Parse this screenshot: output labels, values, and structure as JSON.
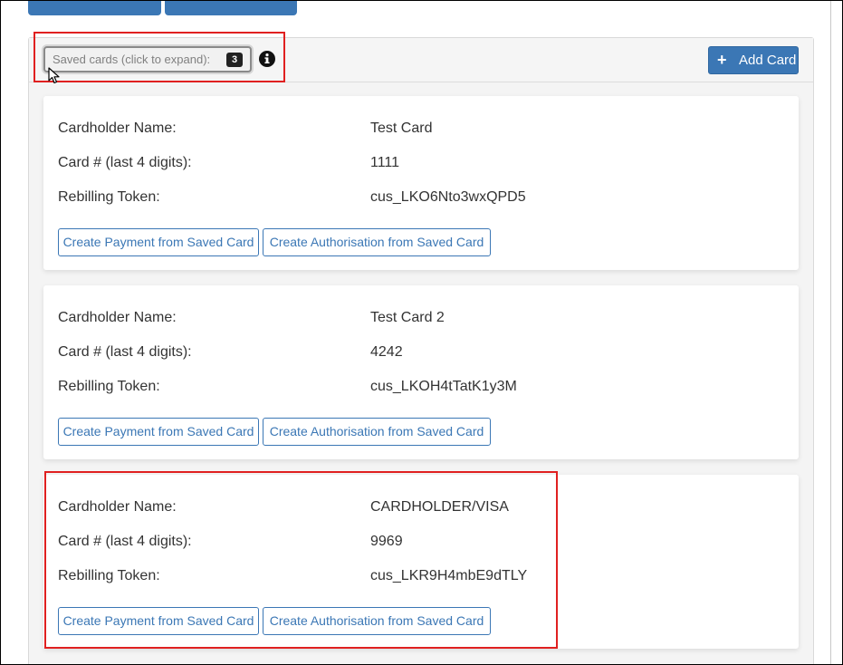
{
  "header": {
    "expand_label": "Saved cards (click to expand):",
    "count": "3",
    "info_icon": "info-circle-icon",
    "add_card_label": "Add Card",
    "add_icon": "plus-icon"
  },
  "labels": {
    "cardholder": "Cardholder Name:",
    "last4": "Card # (last 4 digits):",
    "token": "Rebilling Token:"
  },
  "actions": {
    "payment": "Create Payment from Saved Card",
    "auth": "Create Authorisation from Saved Card"
  },
  "cards": [
    {
      "name": "Test Card",
      "last4": "1111",
      "token": "cus_LKO6Nto3wxQPD5"
    },
    {
      "name": "Test Card 2",
      "last4": "4242",
      "token": "cus_LKOH4tTatK1y3M"
    },
    {
      "name": "CARDHOLDER/VISA",
      "last4": "9969",
      "token": "cus_LKR9H4mbE9dTLY"
    }
  ],
  "colors": {
    "primary": "#3b77b5",
    "highlight": "#e02020"
  }
}
